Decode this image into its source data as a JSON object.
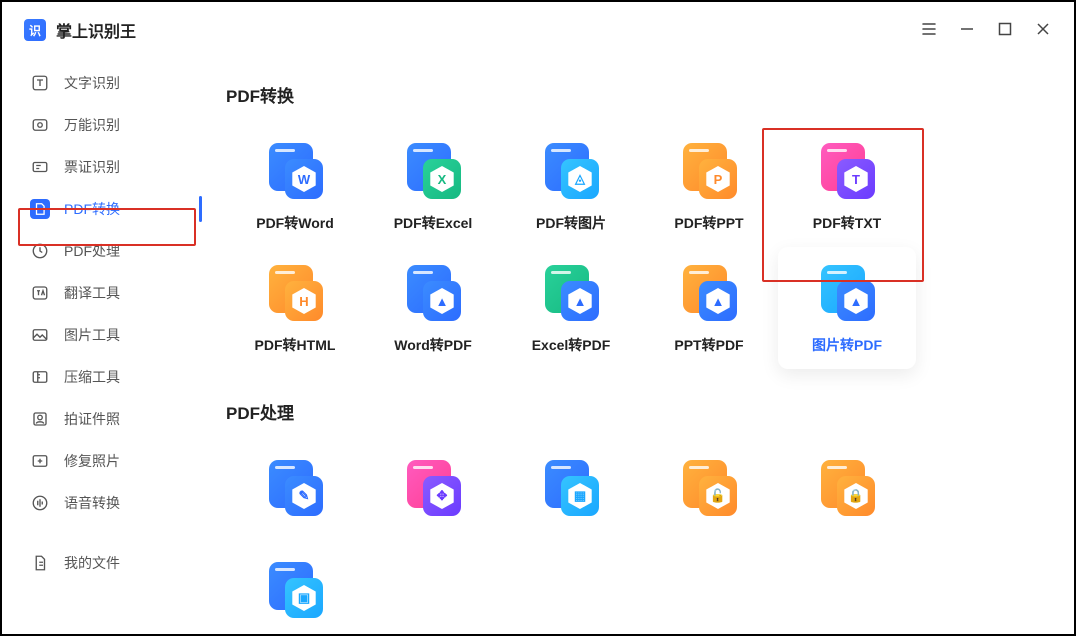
{
  "app": {
    "title": "掌上识别王"
  },
  "sidebar": {
    "items": [
      {
        "label": "文字识别"
      },
      {
        "label": "万能识别"
      },
      {
        "label": "票证识别"
      },
      {
        "label": "PDF转换"
      },
      {
        "label": "PDF处理"
      },
      {
        "label": "翻译工具"
      },
      {
        "label": "图片工具"
      },
      {
        "label": "压缩工具"
      },
      {
        "label": "拍证件照"
      },
      {
        "label": "修复照片"
      },
      {
        "label": "语音转换"
      },
      {
        "label": "我的文件"
      }
    ],
    "active_index": 3
  },
  "sections": [
    {
      "title": "PDF转换",
      "tools": [
        {
          "label": "PDF转Word",
          "badge": "W",
          "back": "blue",
          "front": "blue",
          "txt": "blue"
        },
        {
          "label": "PDF转Excel",
          "badge": "X",
          "back": "blue",
          "front": "green",
          "txt": "green"
        },
        {
          "label": "PDF转图片",
          "badge": "◬",
          "back": "blue",
          "front": "cyan",
          "txt": "cyan"
        },
        {
          "label": "PDF转PPT",
          "badge": "P",
          "back": "orange",
          "front": "orange",
          "txt": "orange"
        },
        {
          "label": "PDF转TXT",
          "badge": "T",
          "back": "pink",
          "front": "purple",
          "txt": "purple"
        },
        {
          "label": "PDF转HTML",
          "badge": "H",
          "back": "orange",
          "front": "orange",
          "txt": "orange"
        },
        {
          "label": "Word转PDF",
          "badge": "▲",
          "back": "blue",
          "front": "blue",
          "txt": "blue"
        },
        {
          "label": "Excel转PDF",
          "badge": "▲",
          "back": "green",
          "front": "blue",
          "txt": "blue"
        },
        {
          "label": "PPT转PDF",
          "badge": "▲",
          "back": "orange",
          "front": "blue",
          "txt": "blue"
        },
        {
          "label": "图片转PDF",
          "badge": "▲",
          "back": "cyan",
          "front": "blue",
          "txt": "blue",
          "selected": true
        }
      ]
    },
    {
      "title": "PDF处理",
      "tools": [
        {
          "label": "",
          "back": "blue",
          "front": "blue"
        },
        {
          "label": "",
          "back": "pink",
          "front": "purple"
        },
        {
          "label": "",
          "back": "blue",
          "front": "cyan"
        },
        {
          "label": "",
          "back": "orange",
          "front": "orange"
        },
        {
          "label": "",
          "back": "orange",
          "front": "orange"
        },
        {
          "label": "",
          "back": "blue",
          "front": "cyan"
        }
      ]
    }
  ],
  "highlights": {
    "sidebar_pdf_convert": true,
    "main_pdf_to_txt": true
  }
}
